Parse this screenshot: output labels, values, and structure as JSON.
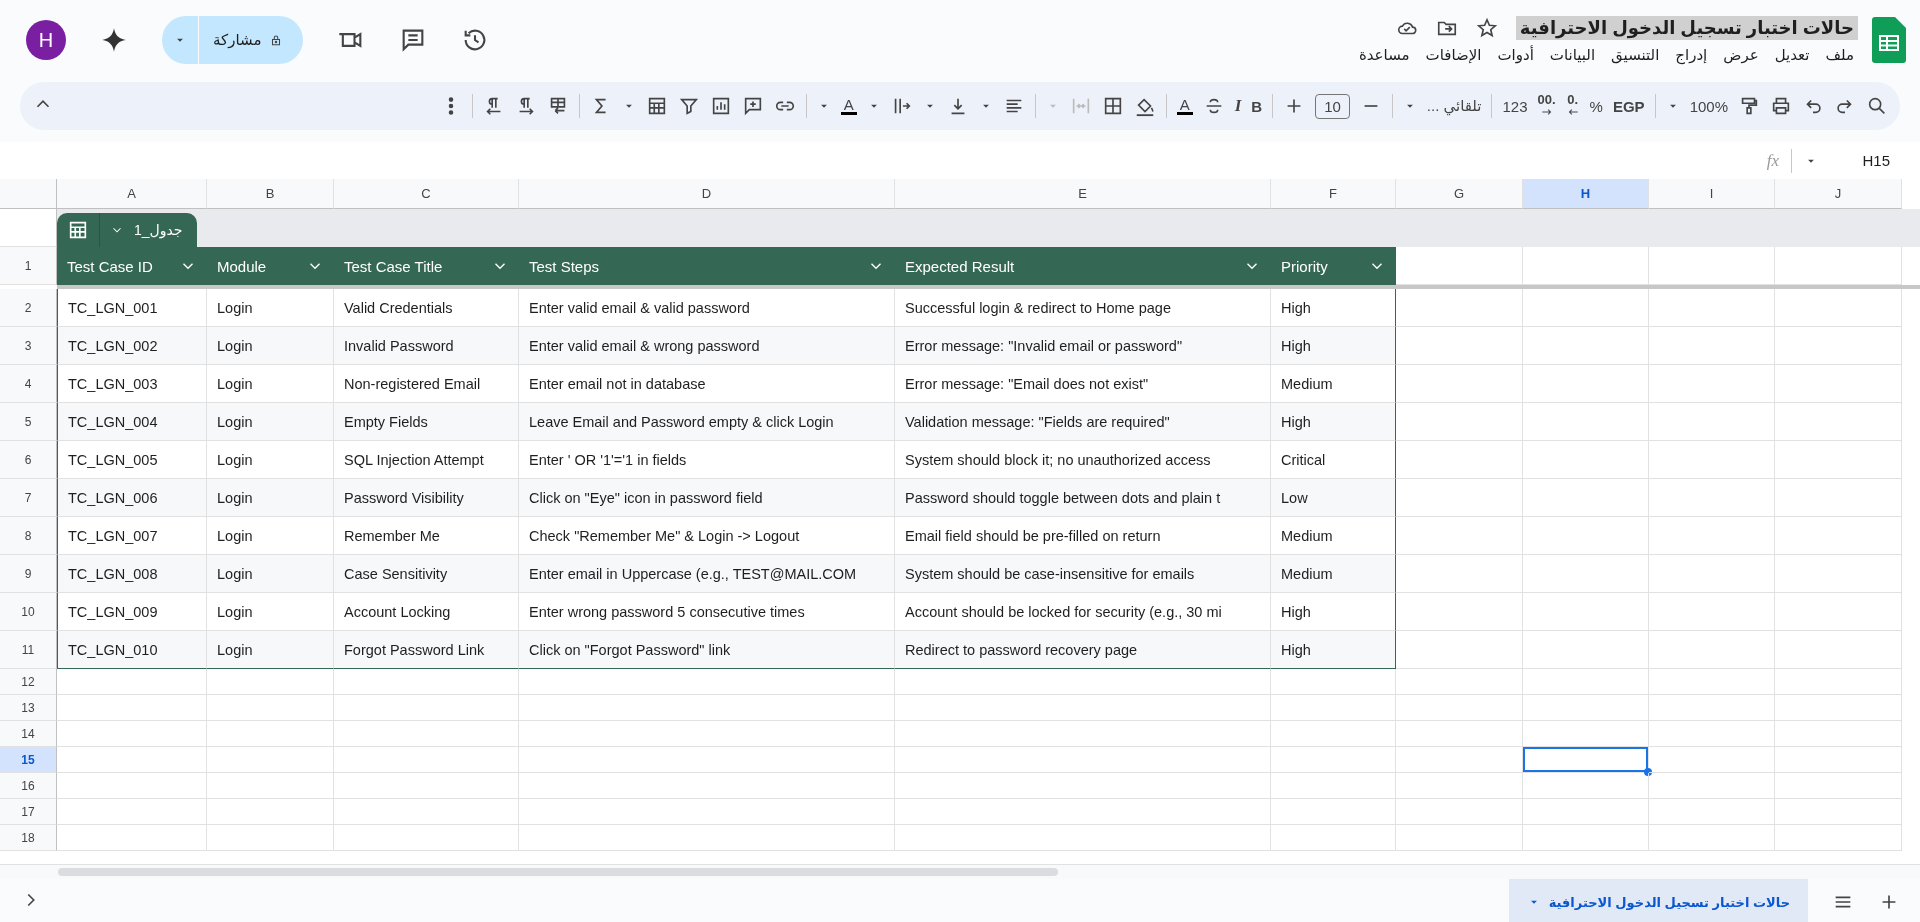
{
  "document": {
    "title": "حالات اختبار تسجيل الدخول الاحترافية"
  },
  "menu": [
    "ملف",
    "تعديل",
    "عرض",
    "إدراج",
    "التنسيق",
    "البيانات",
    "أدوات",
    "الإضافات",
    "مساعدة"
  ],
  "share_button": {
    "label": "مشاركة"
  },
  "avatar": {
    "initial": "H"
  },
  "toolbar": {
    "zoom": "100%",
    "currency": "EGP",
    "percent": "%",
    "decrease_decimal": ".0",
    "increase_decimal": ".00",
    "number_format": "123",
    "font": "تلقائي ...",
    "font_size": "10",
    "bold": "B",
    "italic": "I",
    "text_color": "A",
    "text_rotation": "A"
  },
  "formula_bar": {
    "name_box": "H15",
    "function_label": "fx"
  },
  "columns": [
    {
      "label": "A",
      "selected": false
    },
    {
      "label": "B",
      "selected": false
    },
    {
      "label": "C",
      "selected": false
    },
    {
      "label": "D",
      "selected": false
    },
    {
      "label": "E",
      "selected": false
    },
    {
      "label": "F",
      "selected": false
    },
    {
      "label": "G",
      "selected": false
    },
    {
      "label": "H",
      "selected": true
    },
    {
      "label": "I",
      "selected": false
    },
    {
      "label": "J",
      "selected": false
    }
  ],
  "table": {
    "name": "جدول_1",
    "header_row": "1",
    "columns": [
      "Test Case ID",
      "Module",
      "Test Case Title",
      "Test Steps",
      "Expected Result",
      "Priority"
    ],
    "rows": [
      {
        "row": "2",
        "cells": [
          "TC_LGN_001",
          "Login",
          "Valid Credentials",
          "Enter valid email & valid password",
          "Successful login & redirect to Home page",
          "High"
        ]
      },
      {
        "row": "3",
        "cells": [
          "TC_LGN_002",
          "Login",
          "Invalid Password",
          "Enter valid email & wrong password",
          "Error message: \"Invalid email or password\"",
          "High"
        ]
      },
      {
        "row": "4",
        "cells": [
          "TC_LGN_003",
          "Login",
          "Non-registered Email",
          "Enter email not in database",
          "Error message: \"Email does not exist\"",
          "Medium"
        ]
      },
      {
        "row": "5",
        "cells": [
          "TC_LGN_004",
          "Login",
          "Empty Fields",
          "Leave Email and Password empty & click Login",
          "Validation message: \"Fields are required\"",
          "High"
        ]
      },
      {
        "row": "6",
        "cells": [
          "TC_LGN_005",
          "Login",
          "SQL Injection Attempt",
          "Enter ' OR '1'='1 in fields",
          "System should block it; no unauthorized access",
          "Critical"
        ]
      },
      {
        "row": "7",
        "cells": [
          "TC_LGN_006",
          "Login",
          "Password Visibility",
          "Click on \"Eye\" icon in password field",
          "Password should toggle between dots and plain t",
          "Low"
        ]
      },
      {
        "row": "8",
        "cells": [
          "TC_LGN_007",
          "Login",
          "Remember Me",
          "Check \"Remember Me\" & Login -> Logout",
          "Email field should be pre-filled on return",
          "Medium"
        ]
      },
      {
        "row": "9",
        "cells": [
          "TC_LGN_008",
          "Login",
          "Case Sensitivity",
          "Enter email in Uppercase (e.g., TEST@MAIL.COM",
          "System should be case-insensitive for emails",
          "Medium"
        ]
      },
      {
        "row": "10",
        "cells": [
          "TC_LGN_009",
          "Login",
          "Account Locking",
          "Enter wrong password 5 consecutive times",
          "Account should be locked for security (e.g., 30 mi",
          "High"
        ]
      },
      {
        "row": "11",
        "cells": [
          "TC_LGN_010",
          "Login",
          "Forgot Password Link",
          "Click on \"Forgot Password\" link",
          "Redirect to password recovery page",
          "High"
        ]
      }
    ]
  },
  "empty_rows": [
    {
      "row": "12",
      "selected": false
    },
    {
      "row": "13",
      "selected": false
    },
    {
      "row": "14",
      "selected": false
    },
    {
      "row": "15",
      "selected": true
    },
    {
      "row": "16",
      "selected": false
    },
    {
      "row": "17",
      "selected": false
    },
    {
      "row": "18",
      "selected": false
    }
  ],
  "sheet_tabs": [
    {
      "label": "حالات اختبار تسجيل الدخول الاحترافية",
      "selected": true
    }
  ]
}
